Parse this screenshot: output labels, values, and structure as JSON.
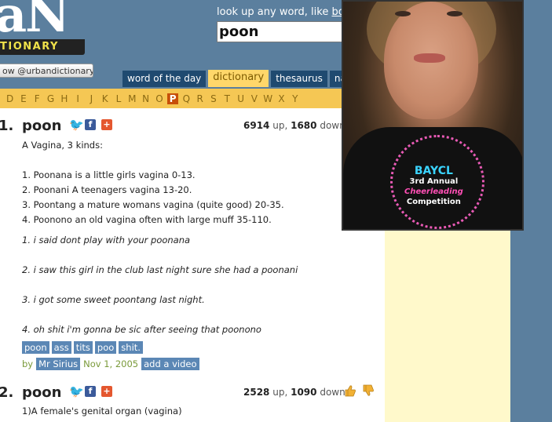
{
  "header": {
    "logo_big": "aN",
    "logo_sub": "TIONARY",
    "follow_button": "ow @urbandictionary",
    "lookup_label_prefix": "look up any word, like ",
    "lookup_label_example": "bo",
    "search_value": "poon"
  },
  "tabs": [
    {
      "label": "word of the day",
      "active": false
    },
    {
      "label": "dictionary",
      "active": true
    },
    {
      "label": "thesaurus",
      "active": false
    },
    {
      "label": "nam",
      "active": false
    }
  ],
  "alphabet": [
    "D",
    "E",
    "F",
    "G",
    "H",
    "I",
    "J",
    "K",
    "L",
    "M",
    "N",
    "O",
    "P",
    "Q",
    "R",
    "S",
    "T",
    "U",
    "V",
    "W",
    "X",
    "Y"
  ],
  "alphabet_active": "P",
  "entries": [
    {
      "num": "1.",
      "word": "poon",
      "votes_up": "6914",
      "up_label": "up,",
      "votes_down": "1680",
      "down_label": "down",
      "definition": [
        "A Vagina, 3 kinds:",
        "",
        "1. Poonana is a little girls vagina 0-13.",
        "2. Poonani A teenagers vagina 13-20.",
        "3. Poontang a mature womans vagina (quite good) 20-35.",
        "4. Poonono an old vagina often with large muff 35-110."
      ],
      "examples": [
        "1. i said dont play with your poonana",
        "2. i saw this girl in the club last night sure she had a poonani",
        "3. i got some sweet poontang last night.",
        "4. oh shit i'm gonna be sic after seeing that poonono"
      ],
      "tags": [
        "poon",
        "ass",
        "tits",
        "poo",
        "shit."
      ],
      "by_label": "by",
      "author": "Mr Sirius",
      "date": "Nov 1, 2005",
      "add_video": "add a video"
    },
    {
      "num": "2.",
      "word": "poon",
      "votes_up": "2528",
      "up_label": "up,",
      "votes_down": "1090",
      "down_label": "down",
      "definition": [
        "1)A female's genital organ (vagina)"
      ]
    }
  ],
  "webcam": {
    "shirt_text_main": "BAYCL",
    "shirt_text_sub": "3rd Annual",
    "shirt_text_cheer": "Cheerleading",
    "shirt_text_comp": "Competition"
  },
  "colors": {
    "page_bg": "#5b7f9e",
    "tab_active": "#ffd76a",
    "alphabet_bar": "#f5c754",
    "alphabet_active": "#c74f09",
    "tag_bg": "#5b87b5",
    "sidebar_bg": "#fff9cb"
  }
}
